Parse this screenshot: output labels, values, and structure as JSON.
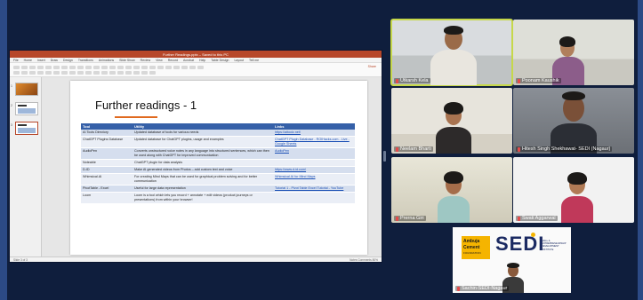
{
  "presentation": {
    "window_title": "Further Readings.pptx – Saved to this PC",
    "menu": [
      "File",
      "Home",
      "Insert",
      "Draw",
      "Design",
      "Transitions",
      "Animations",
      "Slide Show",
      "Review",
      "View",
      "Record",
      "Acrobat",
      "Help",
      "Table Design",
      "Layout",
      "Tell me"
    ],
    "share_label": "Share",
    "status_left": "Slide 3 of 3",
    "status_right": "Notes  Comments  80%",
    "thumb_numbers": [
      "1",
      "2",
      "3"
    ],
    "slide": {
      "title": "Further readings - 1",
      "table": {
        "headers": [
          "Tool",
          "Utility",
          "Links"
        ],
        "rows": [
          [
            "AI Tools Directory",
            "Updated database of tools for various needs",
            "https://aitoolz.net/"
          ],
          [
            "ChatGPT Plugins Database",
            "Updated database for ChatGPT plugins, usage and examples",
            "ChatGPT Plugin Database - ROIHacks.com - Live - Google Sheets"
          ],
          [
            "AudioPen",
            "Converts unstructured voice notes in any language into structured sentences, which can then be used along with ChatGPT for improved communication",
            "AudioPen"
          ],
          [
            "Noteable",
            "ChatGPT plugin for data analysis",
            ""
          ],
          [
            "D-ID",
            "Make AI generated videos from Photos – add custom text and voice",
            "https://www.d-id.com/"
          ],
          [
            "Whimsical.AI",
            "For creating Mind Maps that can be used for graphical problem solving and for better communication",
            "Whimsical AI for Mind Maps"
          ],
          [
            "PivotTable - Excel",
            "Useful for large data representation",
            "Tutorial 1 - Pivot Table Excel Tutorial - YouTube"
          ],
          [
            "Loom",
            "Loom is a tool which lets you record + annotate + edit videos (product journeys or presentations) from within your browser!",
            ""
          ]
        ]
      }
    }
  },
  "participants": [
    {
      "name": "Utkarsh Kela",
      "active": true
    },
    {
      "name": "Poonam Kaushik",
      "active": false
    },
    {
      "name": "Neelam Bharti",
      "active": false
    },
    {
      "name": "Hitesh Singh Shekhawat- SEDI (Nagaur)",
      "active": false
    },
    {
      "name": "Prerna Giri",
      "active": false
    },
    {
      "name": "Swati Aggarwal",
      "active": false
    },
    {
      "name": "Sachin-SEDI-Nagaur",
      "active": false
    }
  ],
  "logo": {
    "ambuja_line1": "Ambuja",
    "ambuja_line2": "Cement",
    "ambuja_line3": "FOUNDATION",
    "sedi": "SEDI",
    "sedi_sub": "SKILL & ENTREPRENEURSHIP DEVELOPMENT INSTITUTE"
  },
  "colors": {
    "accent_ppt": "#b7472a",
    "table_header": "#3560a8",
    "active_speaker_border": "#c6d84a",
    "background": "#0f1e3d"
  }
}
